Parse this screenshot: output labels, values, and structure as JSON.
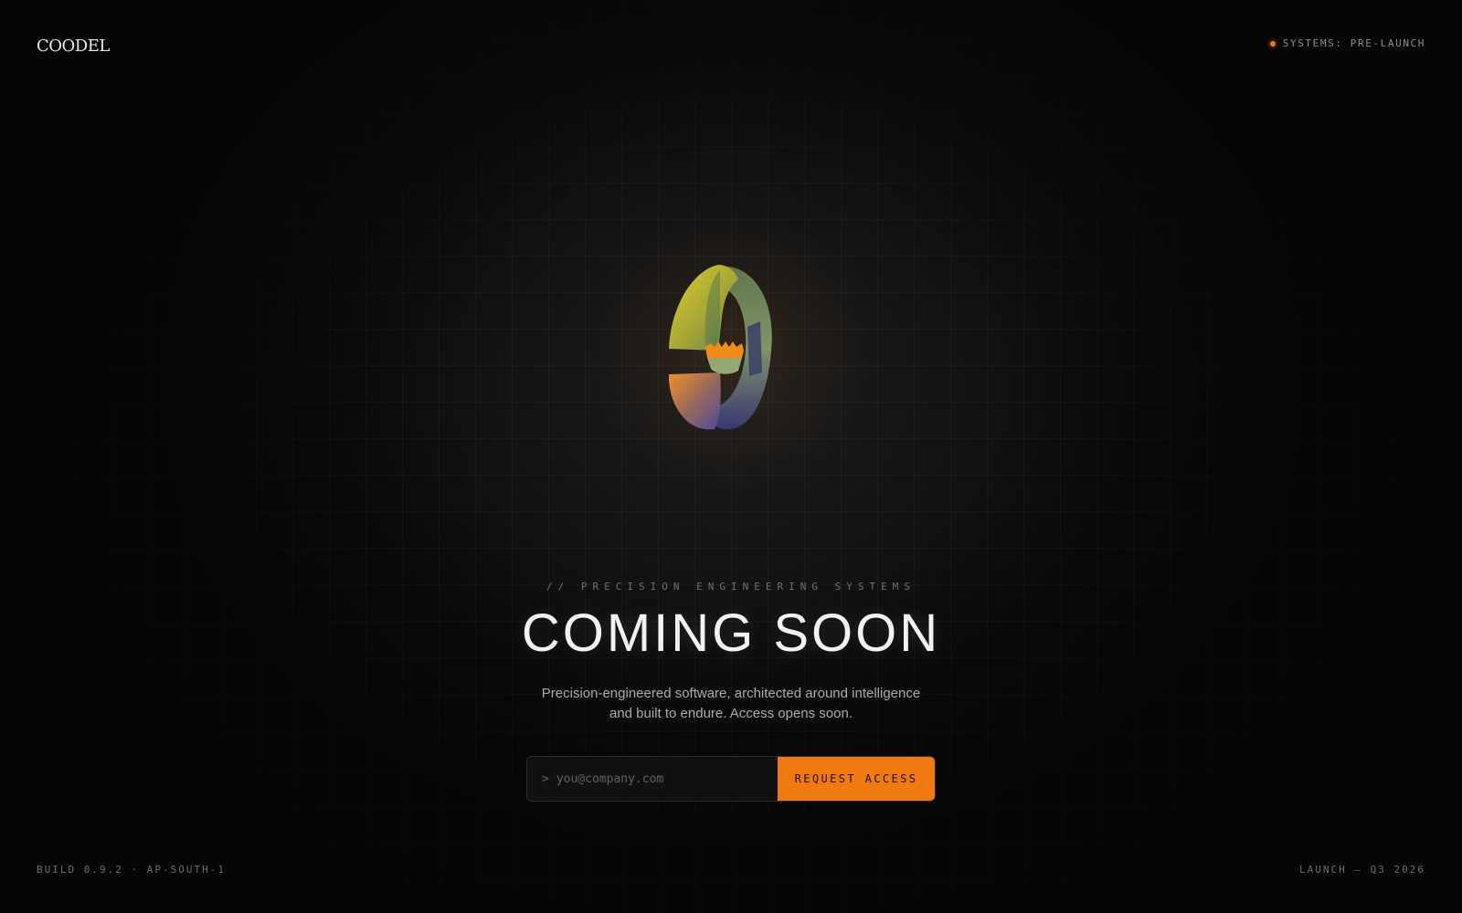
{
  "brand": {
    "logo_text": "COODEL"
  },
  "status": {
    "label": "SYSTEMS: PRE-LAUNCH",
    "dot_color": "#f07a10"
  },
  "emblem": {
    "icon": "abstract-3d-emblem",
    "colors": [
      "#c8c22a",
      "#6a8a6a",
      "#f08a1a",
      "#4a4aa0"
    ]
  },
  "hero": {
    "eyebrow": "// PRECISION ENGINEERING SYSTEMS",
    "headline": "COMING SOON",
    "subtitle": "Precision-engineered software, architected around intelligence and built to endure. Access opens soon."
  },
  "signup": {
    "prompt": ">",
    "placeholder": "you@company.com",
    "value": "",
    "button_label": "REQUEST ACCESS",
    "accent_color": "#f07a10"
  },
  "footer": {
    "left": "BUILD 0.9.2 · AP-SOUTH-1",
    "right": "LAUNCH — Q3 2026"
  }
}
